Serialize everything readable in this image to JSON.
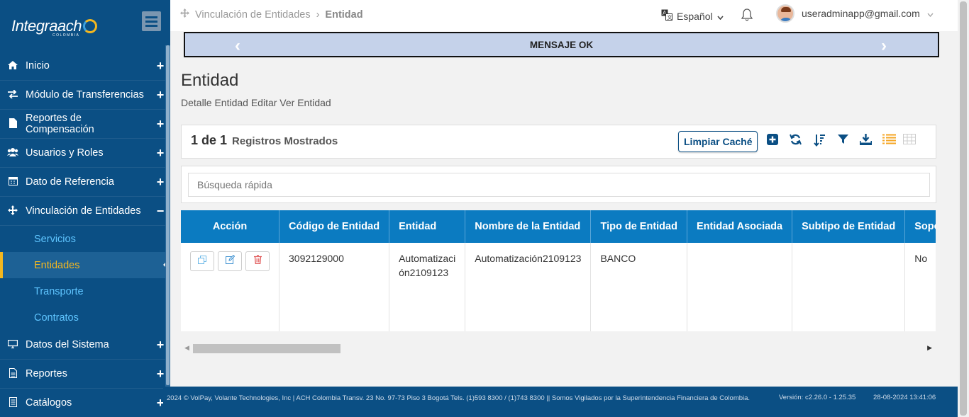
{
  "sidebar": {
    "logo_text": "Integraach",
    "logo_sub": "COLOMBIA",
    "menu": [
      {
        "label": "Inicio",
        "toggle": "+",
        "icon": "home-icon"
      },
      {
        "label": "Módulo de Transferencias",
        "toggle": "+",
        "icon": "exchange-icon"
      },
      {
        "label": "Reportes de Compensación",
        "toggle": "+",
        "icon": "file-icon"
      },
      {
        "label": "Usuarios y Roles",
        "toggle": "+",
        "icon": "users-icon"
      },
      {
        "label": "Dato de Referencia",
        "toggle": "+",
        "icon": "calendar-icon"
      },
      {
        "label": "Vinculación de Entidades",
        "toggle": "−",
        "icon": "arrows-icon"
      }
    ],
    "submenu": [
      "Servicios",
      "Entidades",
      "Transporte",
      "Contratos"
    ],
    "menu2": [
      {
        "label": "Datos del Sistema",
        "toggle": "+",
        "icon": "monitor-icon"
      },
      {
        "label": "Reportes",
        "toggle": "+",
        "icon": "report-icon"
      },
      {
        "label": "Catálogos",
        "toggle": "+",
        "icon": "list-icon"
      }
    ]
  },
  "header": {
    "breadcrumb_parent": "Vinculación de Entidades",
    "breadcrumb_current": "Entidad",
    "language": "Español",
    "user_email": "useradminapp@gmail.com"
  },
  "message": "MENSAJE OK",
  "page": {
    "title": "Entidad",
    "subtitle": "Detalle Entidad Editar Ver Entidad"
  },
  "toolbar": {
    "count": "1 de 1",
    "count_label": "Registros Mostrados",
    "clear_cache": "Limpiar Caché"
  },
  "search": {
    "placeholder": "Búsqueda rápida"
  },
  "table": {
    "headers": [
      "Acción",
      "Código de Entidad",
      "Entidad",
      "Nombre de la Entidad",
      "Tipo de Entidad",
      "Entidad Asociada",
      "Subtipo de Entidad",
      "Soporte"
    ],
    "rows": [
      [
        "",
        "3092129000",
        "Automatizaci ón2109123",
        "Automatización2109123",
        "BANCO",
        "",
        "",
        "No"
      ]
    ]
  },
  "footer": {
    "text": "2024 © VolPay, Volante Technologies, Inc | ACH Colombia Transv. 23 No. 97-73 Piso 3 Bogotá Tels. (1)593 8300 / (1)743 8300 || Somos Vigilados por la Superintendencia Financiera de Colombia.",
    "version": "Versión: c2.26.0 - 1.25.35",
    "date": "28-08-2024 13:41:06"
  }
}
